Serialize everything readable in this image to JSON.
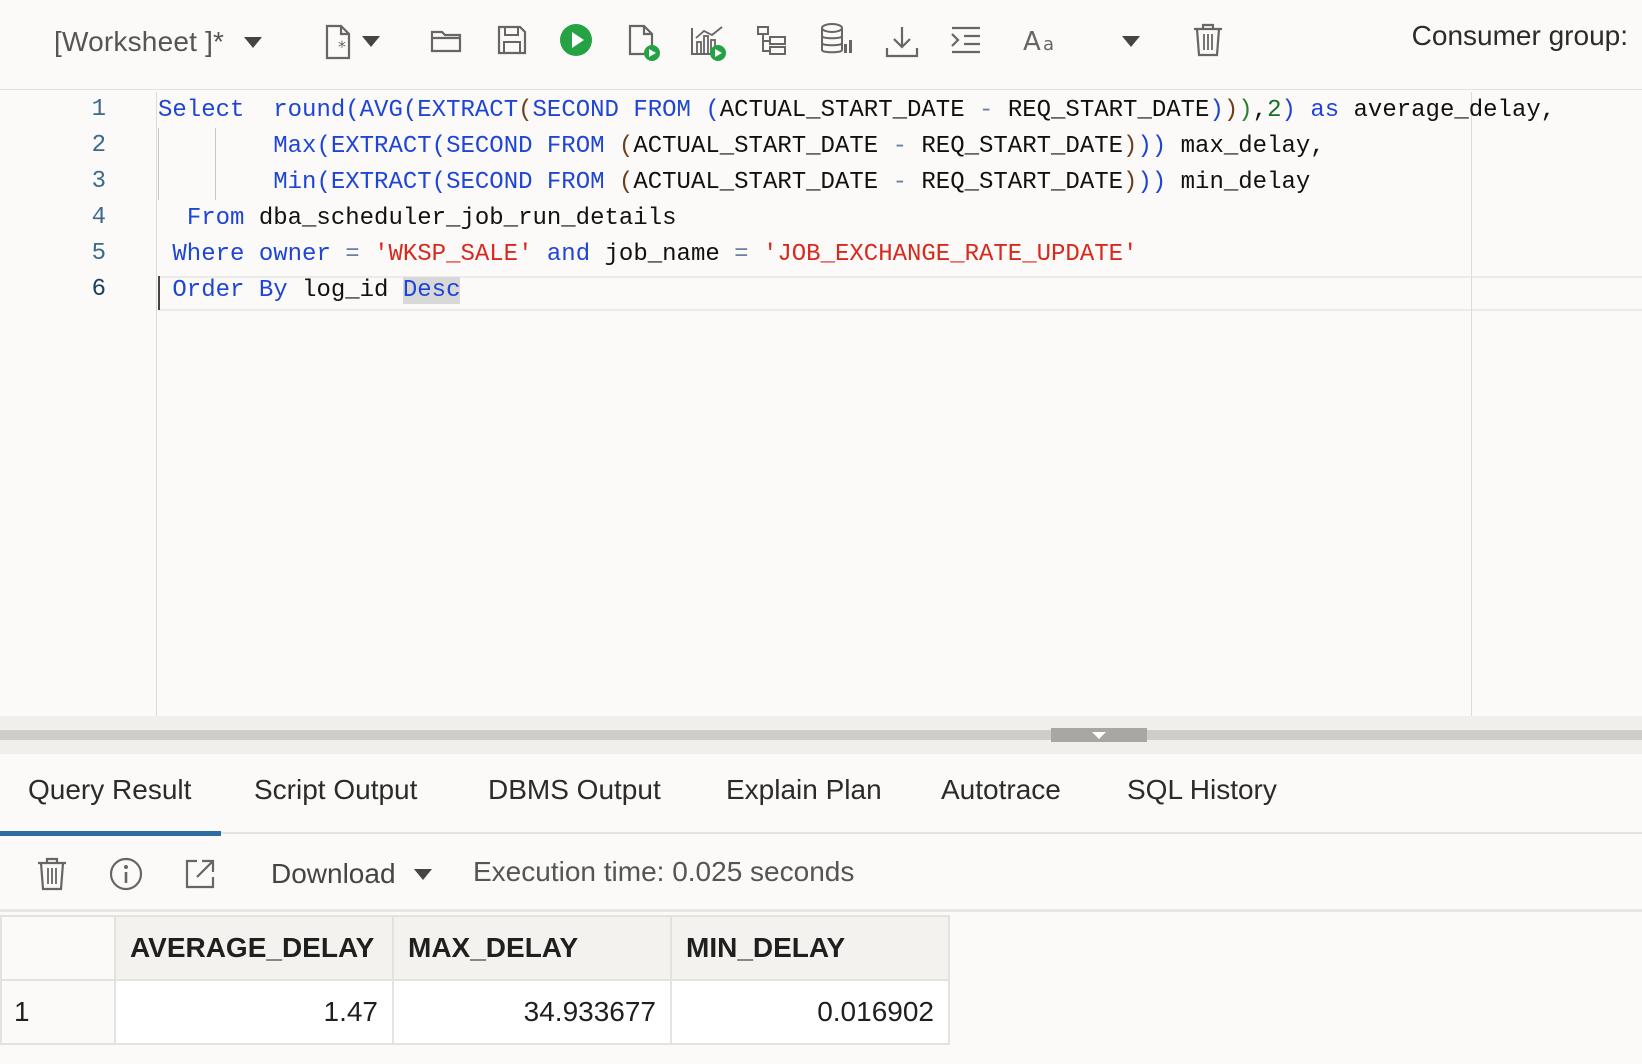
{
  "toolbar": {
    "worksheet_title": "[Worksheet ]*",
    "consumer_group_label": "Consumer group:",
    "icons": [
      "new-file-icon",
      "open-folder-icon",
      "save-icon",
      "run-statement-icon",
      "run-script-icon",
      "autotrace-icon",
      "explain-plan-icon",
      "sql-tuning-icon",
      "download-icon",
      "format-icon",
      "font-size-icon",
      "clear-icon"
    ],
    "run_color": "#25a244"
  },
  "editor": {
    "line_numbers": [
      "1",
      "2",
      "3",
      "4",
      "5",
      "6"
    ],
    "current_line": "6"
  },
  "tabs": {
    "items": [
      "Query Result",
      "Script Output",
      "DBMS Output",
      "Explain Plan",
      "Autotrace",
      "SQL History"
    ],
    "active": "Query Result",
    "accent": "#2e6ca4"
  },
  "results": {
    "download_label": "Download",
    "execution_time": "Execution time: 0.025 seconds",
    "columns": [
      "AVERAGE_DELAY",
      "MAX_DELAY",
      "MIN_DELAY"
    ],
    "rows": [
      {
        "num": "1",
        "cells": [
          "1.47",
          "34.933677",
          "0.016902"
        ]
      }
    ]
  }
}
